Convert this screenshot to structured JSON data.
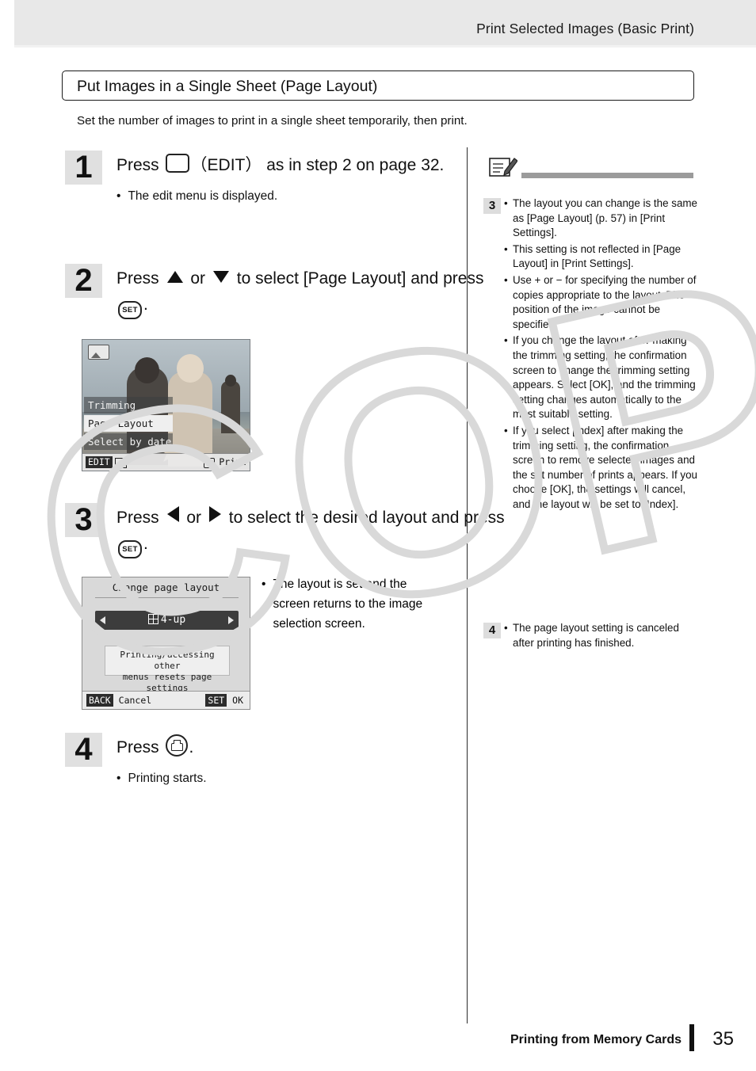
{
  "header": {
    "title": "Print Selected Images (Basic Print)"
  },
  "section": {
    "title": "Put Images in a Single Sheet (Page Layout)",
    "intro": "Set the number of images to print in a single sheet temporarily, then print."
  },
  "steps": [
    {
      "num": "1",
      "text_before": "Press",
      "key": "EDIT",
      "key_paren": "（EDIT）",
      "text_after": "as in step 2 on page 32.",
      "bullets": [
        "The edit menu is displayed."
      ]
    },
    {
      "num": "2",
      "text_1": "Press",
      "text_2": "or",
      "text_3": "to select [Page Layout] and press",
      "set_label": "SET",
      "text_4": ".",
      "bullets": []
    },
    {
      "num": "3",
      "text_1": "Press",
      "text_2": "or",
      "text_3": "to select the desired layout and press",
      "set_label": "SET",
      "text_4": ".",
      "bullets": [
        "The layout is set and the screen returns to the image selection screen."
      ]
    },
    {
      "num": "4",
      "text_1": "Press",
      "text_2": ".",
      "bullets": [
        "Printing starts."
      ]
    }
  ],
  "lcd_photo": {
    "menu_items": [
      "Trimming",
      "Page Layout",
      "Select by date"
    ],
    "selected_index": 1,
    "bottom_left_tag": "EDIT",
    "bottom_right_label": "Print",
    "thumb_icon": "image-icon"
  },
  "lcd_layout": {
    "title": "Change page layout",
    "value": "4-up",
    "note_line_1": "Printing/accessing other",
    "note_line_2": "menus resets page settings",
    "back_tag": "BACK",
    "back_label": "Cancel",
    "set_tag": "SET",
    "set_label": "OK"
  },
  "notes": {
    "icon": "memo-pencil-icon",
    "groups": [
      {
        "num": "3",
        "items": [
          "The layout you can change is the same as [Page Layout] (p. 57) in [Print Settings].",
          "This setting is not reflected in [Page Layout] in [Print Settings].",
          "Use  +  or  −  for specifying the number of copies appropriate to the layout. The position of the image cannot be specified.",
          "If you change the layout after making the trimming setting, the confirmation screen to change the trimming setting appears. Select [OK], and the trimming setting changes automatically to the most suitable setting.",
          "If you select [Index] after making the trimming setting, the confirmation screen to remove selected images and the set number of prints appears. If you choose [OK], the settings will cancel, and the layout will be set to [Index]."
        ]
      },
      {
        "num": "4",
        "items": [
          "The page layout setting is canceled after printing has finished."
        ]
      }
    ]
  },
  "footer": {
    "label": "Printing from Memory Cards",
    "page": "35"
  },
  "watermark": {
    "text": "COPY"
  }
}
